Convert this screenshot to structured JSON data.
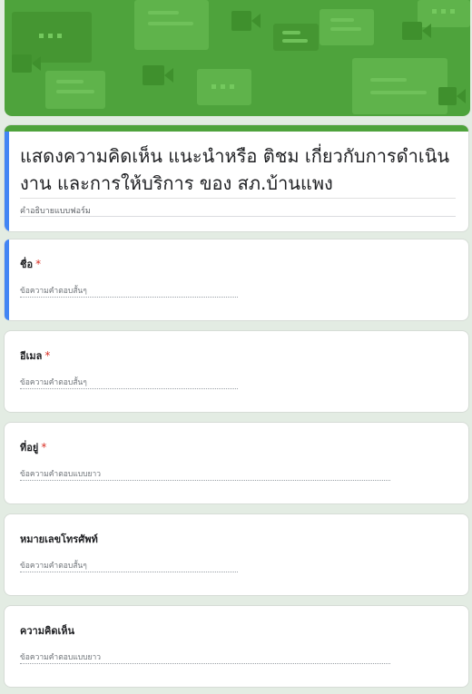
{
  "form": {
    "title": "แสดงความคิดเห็น แนะนำหรือ ติชม เกี่ยวกับการดำเนินงาน และการให้บริการ ของ สภ.บ้านแพง",
    "description_placeholder": "คำอธิบายแบบฟอร์ม"
  },
  "questions": [
    {
      "label": "ชื่อ",
      "required": "*",
      "placeholder": "ข้อความคำตอบสั้นๆ"
    },
    {
      "label": "อีเมล",
      "required": "*",
      "placeholder": "ข้อความคำตอบสั้นๆ"
    },
    {
      "label": "ที่อยู่",
      "required": "*",
      "placeholder": "ข้อความคำตอบแบบยาว"
    },
    {
      "label": "หมายเลขโทรศัพท์",
      "required": "",
      "placeholder": "ข้อความคำตอบสั้นๆ"
    },
    {
      "label": "ความคิดเห็น",
      "required": "",
      "placeholder": "ข้อความคำตอบแบบยาว"
    }
  ],
  "colors": {
    "theme_green": "#4ea33c",
    "focus_blue": "#4285f4",
    "required_red": "#d93025",
    "page_background": "#e3ece3"
  },
  "icons": [
    "chat-bubble-icon",
    "video-camera-icon"
  ]
}
